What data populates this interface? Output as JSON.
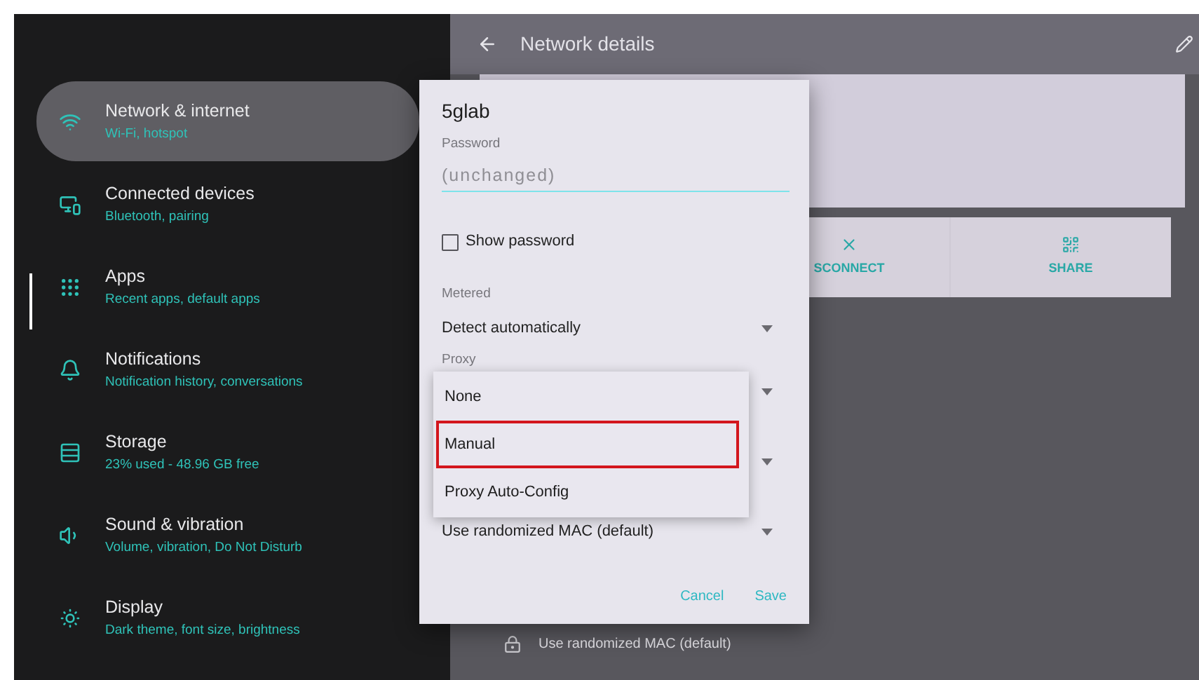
{
  "sidebar": {
    "items": [
      {
        "kind": "wifi",
        "title": "Network & internet",
        "subtitle": "Wi-Fi, hotspot",
        "selected": true
      },
      {
        "kind": "devices",
        "title": "Connected devices",
        "subtitle": "Bluetooth, pairing",
        "selected": false
      },
      {
        "kind": "apps",
        "title": "Apps",
        "subtitle": "Recent apps, default apps",
        "selected": false
      },
      {
        "kind": "bell",
        "title": "Notifications",
        "subtitle": "Notification history, conversations",
        "selected": false
      },
      {
        "kind": "storage",
        "title": "Storage",
        "subtitle": "23% used - 48.96 GB free",
        "selected": false
      },
      {
        "kind": "sound",
        "title": "Sound & vibration",
        "subtitle": "Volume, vibration, Do Not Disturb",
        "selected": false
      },
      {
        "kind": "display",
        "title": "Display",
        "subtitle": "Dark theme, font size, brightness",
        "selected": false
      }
    ]
  },
  "header": {
    "title": "Network details"
  },
  "actions": [
    {
      "kind": "close",
      "label": "SCONNECT"
    },
    {
      "kind": "qr",
      "label": "SHARE"
    }
  ],
  "privacy_row": {
    "value": "Use randomized MAC (default)"
  },
  "dialog": {
    "title": "5glab",
    "password": {
      "label": "Password",
      "placeholder": "(unchanged)"
    },
    "show_password": {
      "label": "Show password",
      "checked": false
    },
    "metered": {
      "label": "Metered",
      "value": "Detect automatically"
    },
    "proxy": {
      "label": "Proxy"
    },
    "privacy": {
      "value": "Use randomized MAC (default)"
    },
    "buttons": [
      "Cancel",
      "Save"
    ]
  },
  "proxy_menu": {
    "items": [
      {
        "label": "None",
        "highlighted": false
      },
      {
        "label": "Manual",
        "highlighted": true
      },
      {
        "label": "Proxy Auto-Config",
        "highlighted": false
      }
    ]
  }
}
